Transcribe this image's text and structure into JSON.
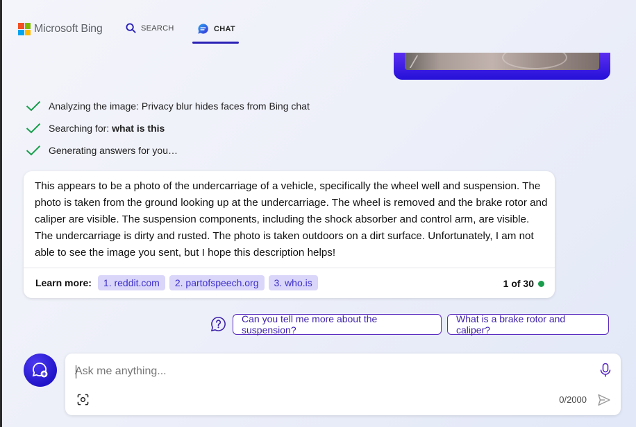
{
  "header": {
    "brand": "Microsoft Bing",
    "brand_colors": [
      "#f25022",
      "#7fba00",
      "#00a4ef",
      "#ffb900"
    ],
    "tabs": [
      {
        "label": "SEARCH",
        "icon": "search-icon",
        "active": false
      },
      {
        "label": "CHAT",
        "icon": "chat-bubble-icon",
        "active": true
      }
    ]
  },
  "steps": [
    {
      "prefix": "Analyzing the image: Privacy blur hides faces from Bing chat",
      "bold": ""
    },
    {
      "prefix": "Searching for: ",
      "bold": "what is this"
    },
    {
      "prefix": "Generating answers for you…",
      "bold": ""
    }
  ],
  "answer": {
    "text": "This appears to be a photo of the undercarriage of a vehicle, specifically the wheel well and suspension. The photo is taken from the ground looking up at the undercarriage. The wheel is removed and the brake rotor and caliper are visible. The suspension components, including the shock absorber and control arm, are visible. The undercarriage is dirty and rusted. The photo is taken outdoors on a dirt surface. Unfortunately, I am not able to see the image you sent, but I hope this description helps!",
    "learn_more_label": "Learn more:",
    "sources": [
      "1. reddit.com",
      "2. partofspeech.org",
      "3. who.is"
    ],
    "counter": "1 of 30",
    "status_color": "#1a9e4d"
  },
  "suggestions": [
    "Can you tell me more about the suspension?",
    "What is a brake rotor and caliper?"
  ],
  "composer": {
    "placeholder": "Ask me anything...",
    "value": "",
    "char_count": "0/2000"
  },
  "colors": {
    "accent": "#2a20b5",
    "user_bubble": "#3b1fe0",
    "chip_bg": "#d9d6fa"
  }
}
